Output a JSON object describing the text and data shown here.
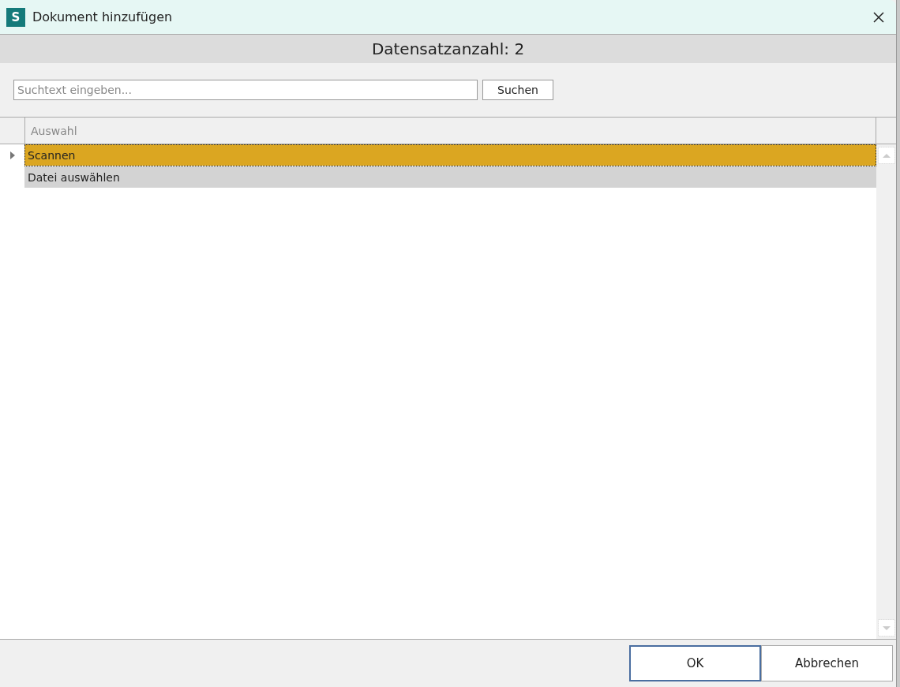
{
  "window": {
    "title": "Dokument hinzufügen",
    "app_icon_letter": "S"
  },
  "record_count": "Datensatzanzahl: 2",
  "search": {
    "placeholder": "Suchtext eingeben...",
    "button": "Suchen"
  },
  "table": {
    "columns": [
      "Auswahl"
    ],
    "rows": [
      {
        "cells": [
          "Scannen"
        ],
        "selected": true
      },
      {
        "cells": [
          "Datei auswählen"
        ],
        "selected": false
      }
    ]
  },
  "buttons": [
    {
      "label": "OK",
      "default": true
    },
    {
      "label": "Abbrechen",
      "default": false
    }
  ]
}
